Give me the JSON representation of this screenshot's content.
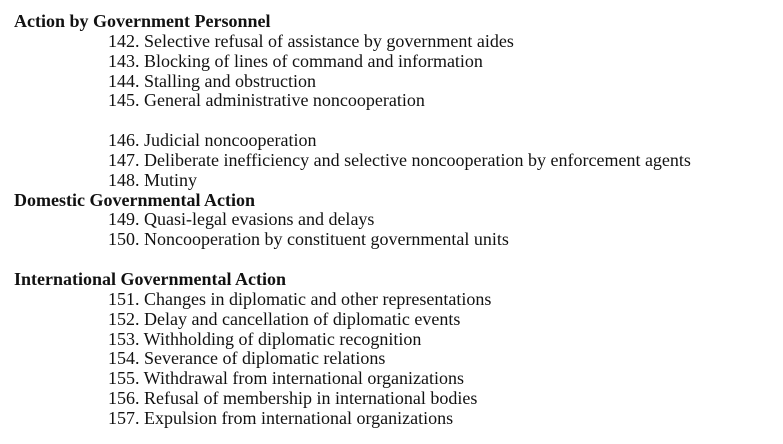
{
  "sections": [
    {
      "heading": "Action by Government Personnel",
      "items": [
        "142. Selective refusal of assistance by government aides",
        "143. Blocking of lines of command and information",
        "144. Stalling and obstruction",
        "145. General administrative noncooperation",
        "",
        "146. Judicial noncooperation",
        "147. Deliberate inefficiency and selective noncooperation by enforcement agents",
        "148. Mutiny"
      ]
    },
    {
      "heading": "Domestic Governmental Action",
      "items": [
        "149. Quasi-legal evasions and delays",
        "150. Noncooperation by constituent governmental units",
        ""
      ]
    },
    {
      "heading": "International Governmental Action",
      "items": [
        "151. Changes in diplomatic and other representations",
        "152. Delay and cancellation of diplomatic events",
        "153. Withholding of diplomatic recognition",
        "154. Severance of diplomatic relations",
        "155. Withdrawal from international organizations",
        "156. Refusal of membership in international bodies",
        "157. Expulsion from international organizations"
      ]
    }
  ]
}
